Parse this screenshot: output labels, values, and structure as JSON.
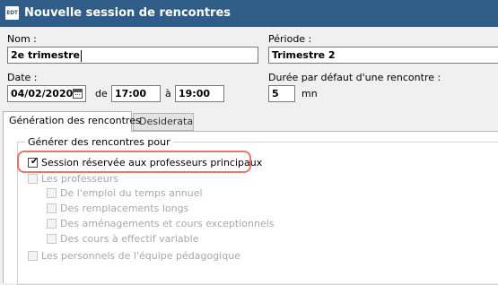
{
  "window": {
    "app_badge": "EDT",
    "title": "Nouvelle session de rencontres"
  },
  "form": {
    "nom_label": "Nom :",
    "nom_value": "2e trimestre",
    "periode_label": "Période :",
    "periode_value": "Trimestre 2",
    "date_label": "Date :",
    "date_value": "04/02/2020",
    "de_label": "de",
    "time_from": "17:00",
    "a_label": "à",
    "time_to": "19:00",
    "duree_label": "Durée par défaut d'une rencontre :",
    "duree_value": "5",
    "duree_unit": "mn"
  },
  "tabs": [
    {
      "label": "Génération des rencontres",
      "active": true
    },
    {
      "label": "Desiderata",
      "active": false
    }
  ],
  "group": {
    "legend": "Générer des rencontres pour",
    "options": [
      {
        "label": "Session réservée aux professeurs principaux",
        "checked": true,
        "enabled": true
      },
      {
        "label": "Les professeurs",
        "checked": false,
        "enabled": false
      },
      {
        "label": "De l'emploi du temps annuel",
        "checked": false,
        "enabled": false
      },
      {
        "label": "Des remplacements longs",
        "checked": false,
        "enabled": false
      },
      {
        "label": "Des aménagements et cours exceptionnels",
        "checked": false,
        "enabled": false
      },
      {
        "label": "Des cours à effectif variable",
        "checked": false,
        "enabled": false
      },
      {
        "label": "Les personnels de l'équipe pédagogique",
        "checked": false,
        "enabled": false
      }
    ]
  },
  "colors": {
    "titlebar": "#2f5d87",
    "highlight": "#e8756a",
    "disabled_text": "#a7a7a7"
  }
}
